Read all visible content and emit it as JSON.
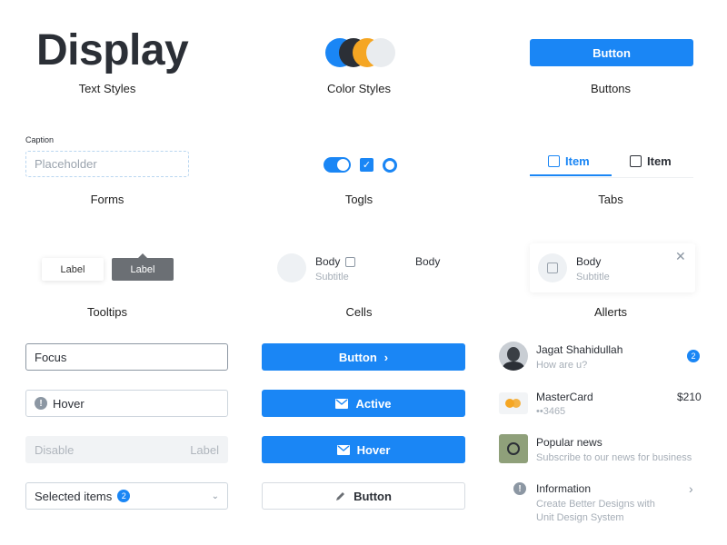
{
  "sections": {
    "text_styles": "Text Styles",
    "color_styles": "Color Styles",
    "buttons": "Buttons",
    "forms": "Forms",
    "toggles": "Togls",
    "tabs": "Tabs",
    "tooltips": "Tooltips",
    "cells": "Cells",
    "alerts": "Allerts"
  },
  "display_text": "Display",
  "colors": {
    "primary": "#1a86f5",
    "dark": "#2b2f36",
    "accent": "#f5a623",
    "light": "#e9ecef"
  },
  "buttons": {
    "primary_label": "Button"
  },
  "forms": {
    "caption": "Caption",
    "placeholder": "Placeholder"
  },
  "tabs": {
    "items": [
      {
        "label": "Item",
        "active": true
      },
      {
        "label": "Item",
        "active": false
      }
    ]
  },
  "tooltips": {
    "light": "Label",
    "dark": "Label"
  },
  "cells": {
    "body": "Body",
    "subtitle": "Subtitle",
    "body_right": "Body"
  },
  "alert": {
    "body": "Body",
    "subtitle": "Subtitle",
    "close_icon": "close-icon"
  },
  "inputs": {
    "focus_value": "Focus",
    "hover_value": "Hover",
    "disabled_value": "Disable",
    "disabled_label": "Label",
    "select_value": "Selected items",
    "select_badge": "2"
  },
  "action_buttons": {
    "button_chevron": "Button",
    "active": "Active",
    "hover": "Hover",
    "outline": "Button"
  },
  "list": [
    {
      "title": "Jagat Shahidullah",
      "subtitle": "How are u?",
      "badge": "2"
    },
    {
      "title": "MasterCard",
      "subtitle": "••3465",
      "amount": "$210"
    },
    {
      "title": "Popular news",
      "subtitle": "Subscribe to our news for business"
    },
    {
      "title": "Information",
      "subtitle": "Create Better Designs with Unit Design System"
    }
  ]
}
